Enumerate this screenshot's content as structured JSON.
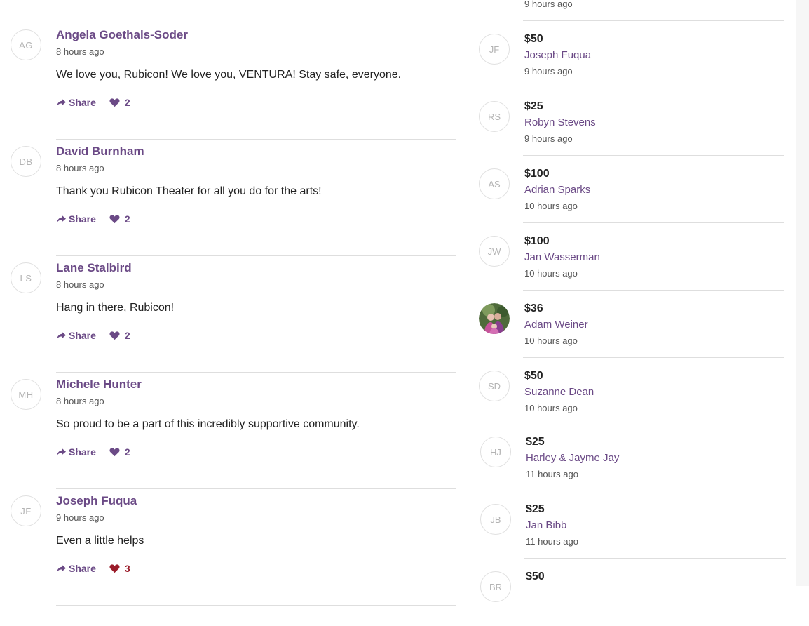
{
  "comments": [
    {
      "initials": "AG",
      "name": "Angela Goethals-Soder",
      "time": "8 hours ago",
      "text": "We love you, Rubicon! We love you, VENTURA! Stay safe, everyone.",
      "share_label": "Share",
      "likes": "2",
      "liked": false
    },
    {
      "initials": "DB",
      "name": "David Burnham",
      "time": "8 hours ago",
      "text": "Thank you Rubicon Theater for all you do for the arts!",
      "share_label": "Share",
      "likes": "2",
      "liked": false
    },
    {
      "initials": "LS",
      "name": "Lane Stalbird",
      "time": "8 hours ago",
      "text": "Hang in there, Rubicon!",
      "share_label": "Share",
      "likes": "2",
      "liked": false
    },
    {
      "initials": "MH",
      "name": "Michele Hunter",
      "time": "8 hours ago",
      "text": "So proud to be a part of this incredibly supportive community.",
      "share_label": "Share",
      "likes": "2",
      "liked": false
    },
    {
      "initials": "JF",
      "name": "Joseph Fuqua",
      "time": "9 hours ago",
      "text": "Even a little helps",
      "share_label": "Share",
      "likes": "3",
      "liked": true
    }
  ],
  "donations_top_time": "9 hours ago",
  "donations": [
    {
      "initials": "JF",
      "amount": "$50",
      "name": "Joseph Fuqua",
      "time": "9 hours ago",
      "photo": false
    },
    {
      "initials": "RS",
      "amount": "$25",
      "name": "Robyn Stevens",
      "time": "9 hours ago",
      "photo": false
    },
    {
      "initials": "AS",
      "amount": "$100",
      "name": "Adrian Sparks",
      "time": "10 hours ago",
      "photo": false
    },
    {
      "initials": "JW",
      "amount": "$100",
      "name": "Jan Wasserman",
      "time": "10 hours ago",
      "photo": false
    },
    {
      "initials": "",
      "amount": "$36",
      "name": "Adam Weiner",
      "time": "10 hours ago",
      "photo": true
    },
    {
      "initials": "SD",
      "amount": "$50",
      "name": "Suzanne Dean",
      "time": "10 hours ago",
      "photo": false
    },
    {
      "initials": "HJ",
      "amount": "$25",
      "name": "Harley & Jayme Jay",
      "time": "11 hours ago",
      "photo": false
    },
    {
      "initials": "JB",
      "amount": "$25",
      "name": "Jan Bibb",
      "time": "11 hours ago",
      "photo": false
    },
    {
      "initials": "BR",
      "amount": "$50",
      "name": "",
      "time": "",
      "photo": false
    }
  ],
  "colors": {
    "accent": "#6b4a86",
    "liked": "#9a1c2a",
    "rule": "#dedede"
  },
  "icons": {
    "share": "share-icon",
    "like": "heart-icon"
  }
}
